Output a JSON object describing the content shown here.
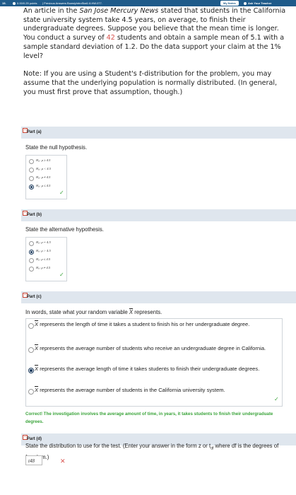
{
  "topbar": {
    "number": "15.",
    "points": "0.00/0.25 points",
    "prev": "| Previous Answers  BowslyIntroStat1 8.HW.077.",
    "notes": "My Notes",
    "ask": "Ask Your Teacher"
  },
  "question": {
    "p1_a": "An article in the ",
    "p1_pub": "San Jose Mercury News",
    "p1_b": " stated that students in the California state university system take 4.5 years, on average, to finish their undergraduate degrees. Suppose you believe that the mean time is longer. You conduct a survey of ",
    "p1_n": "42",
    "p1_c": " students and obtain a sample mean of 5.1 with a sample standard deviation of 1.2. Do the data support your claim at the 1% level?",
    "p2_a": "Note: If you are using a Student's ",
    "p2_t": "t",
    "p2_b": "-distribution for the problem, you may assume that the underlying population is normally distributed. (In general, you must first prove that assumption, though.)"
  },
  "parts": {
    "a": {
      "label": "Part (a)",
      "prompt": "State the null hypothesis.",
      "options": [
        "H₀: μ ≥ 4.5",
        "H₀: μ < 4.5",
        "H₀: μ ≠ 4.5",
        "H₀: μ ≤ 4.5"
      ]
    },
    "b": {
      "label": "Part (b)",
      "prompt": "State the alternative hypothesis.",
      "options": [
        "Hₐ: μ = 4.5",
        "Hₐ: μ > 4.5",
        "Hₐ: μ ≤ 4.5",
        "Hₐ: μ ≠ 4.5"
      ]
    },
    "c": {
      "label": "Part (c)",
      "prompt_a": "In words, state what your random variable ",
      "prompt_x": "X",
      "prompt_b": " represents.",
      "options": [
        {
          "x": "X",
          "text": " represents the length of time it takes a student to finish his or her undergraduate degree."
        },
        {
          "x": "X",
          "text": " represents the average number of students who receive an undergraduate degree in California."
        },
        {
          "x": "X",
          "text": " represents the average length of time it takes students to finish their undergraduate degrees."
        },
        {
          "x": "X",
          "text": " represents the average number of students in the California university system."
        }
      ],
      "feedback": "Correct! The investigation involves the average amount of time, in years, it takes students to finish their undergraduate degrees."
    },
    "d": {
      "label": "Part (d)",
      "prompt": "State the distribution to use for the test. (Enter your answer in the form z or t",
      "prompt_sub": "df",
      "prompt_b": " where df is the degrees of freedom.)",
      "answer": "t48"
    }
  },
  "colors": {
    "accent": "#1f5b8a",
    "correct": "#3aa43a",
    "wrong": "#d9534f",
    "part_bg": "#dfe6ee"
  }
}
